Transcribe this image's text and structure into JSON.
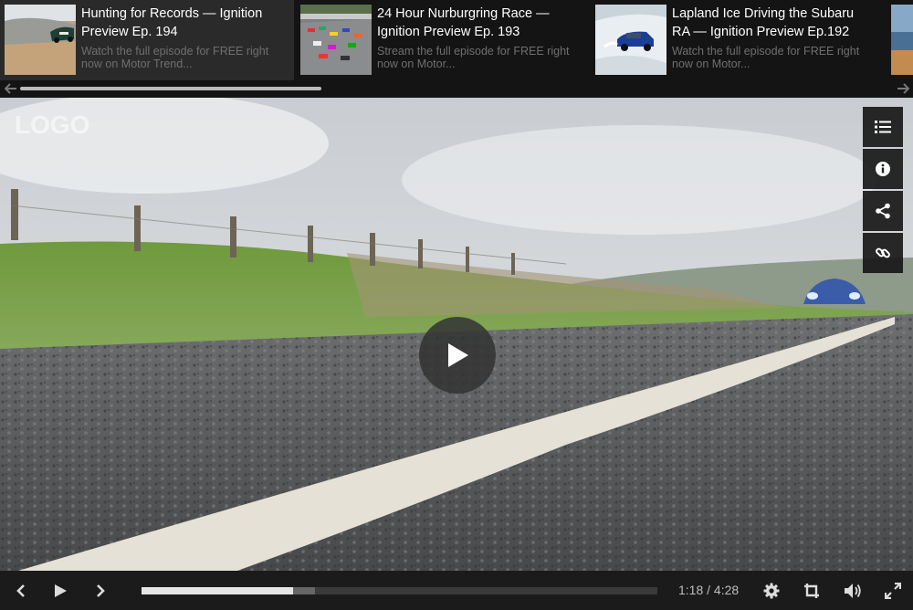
{
  "playlist": {
    "items": [
      {
        "title": "Hunting for Records — Ignition Preview Ep. 194",
        "description": "Watch the full episode for FREE right now on Motor Trend...",
        "thumb": "racing-car-thumbnail"
      },
      {
        "title": "24 Hour Nurburgring Race — Ignition Preview Ep. 193",
        "description": "Stream the full episode for FREE right now on Motor...",
        "thumb": "race-track-thumbnail"
      },
      {
        "title": "Lapland Ice Driving the Subaru RA — Ignition Preview Ep.192",
        "description": "Watch the full episode for FREE right now on Motor...",
        "thumb": "snow-car-thumbnail"
      }
    ],
    "prev_icon": "arrow-left-icon",
    "next_icon": "arrow-right-icon"
  },
  "player": {
    "logo": "LOGO",
    "side_buttons": [
      "list-icon",
      "info-icon",
      "share-icon",
      "link-icon"
    ],
    "play_icon": "play-icon",
    "progress_fraction": 0.294,
    "buffered_fraction": 0.336
  },
  "controls": {
    "prev_icon": "chevron-left-icon",
    "play_icon": "play-icon",
    "next_icon": "chevron-right-icon",
    "time": "1:18 / 4:28",
    "settings_icon": "gear-icon",
    "crop_icon": "crop-icon",
    "volume_icon": "volume-icon",
    "fullscreen_icon": "fullscreen-icon"
  },
  "colors": {
    "bar_bg": "#1b1b1b",
    "playlist_bg": "#141414",
    "active_item_bg": "#2a2a2a",
    "progress_played": "#e6e6e6"
  }
}
